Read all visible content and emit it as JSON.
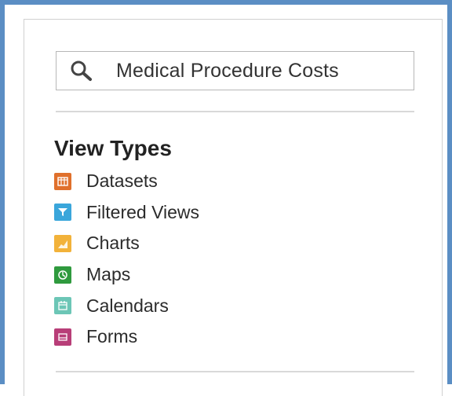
{
  "search": {
    "value": "Medical Procedure Costs",
    "icon": "search-icon"
  },
  "view_types": {
    "title": "View Types",
    "items": [
      {
        "label": "Datasets",
        "icon": "dataset-icon",
        "color": "#e0702c"
      },
      {
        "label": "Filtered Views",
        "icon": "filter-icon",
        "color": "#3aa6db"
      },
      {
        "label": "Charts",
        "icon": "chart-icon",
        "color": "#f2b23a"
      },
      {
        "label": "Maps",
        "icon": "map-icon",
        "color": "#2f9a3e"
      },
      {
        "label": "Calendars",
        "icon": "calendar-icon",
        "color": "#6cc6b6"
      },
      {
        "label": "Forms",
        "icon": "form-icon",
        "color": "#b83e78"
      }
    ]
  },
  "colors": {
    "frame_border": "#5b8ec4",
    "panel_border": "#d0d0d0"
  }
}
